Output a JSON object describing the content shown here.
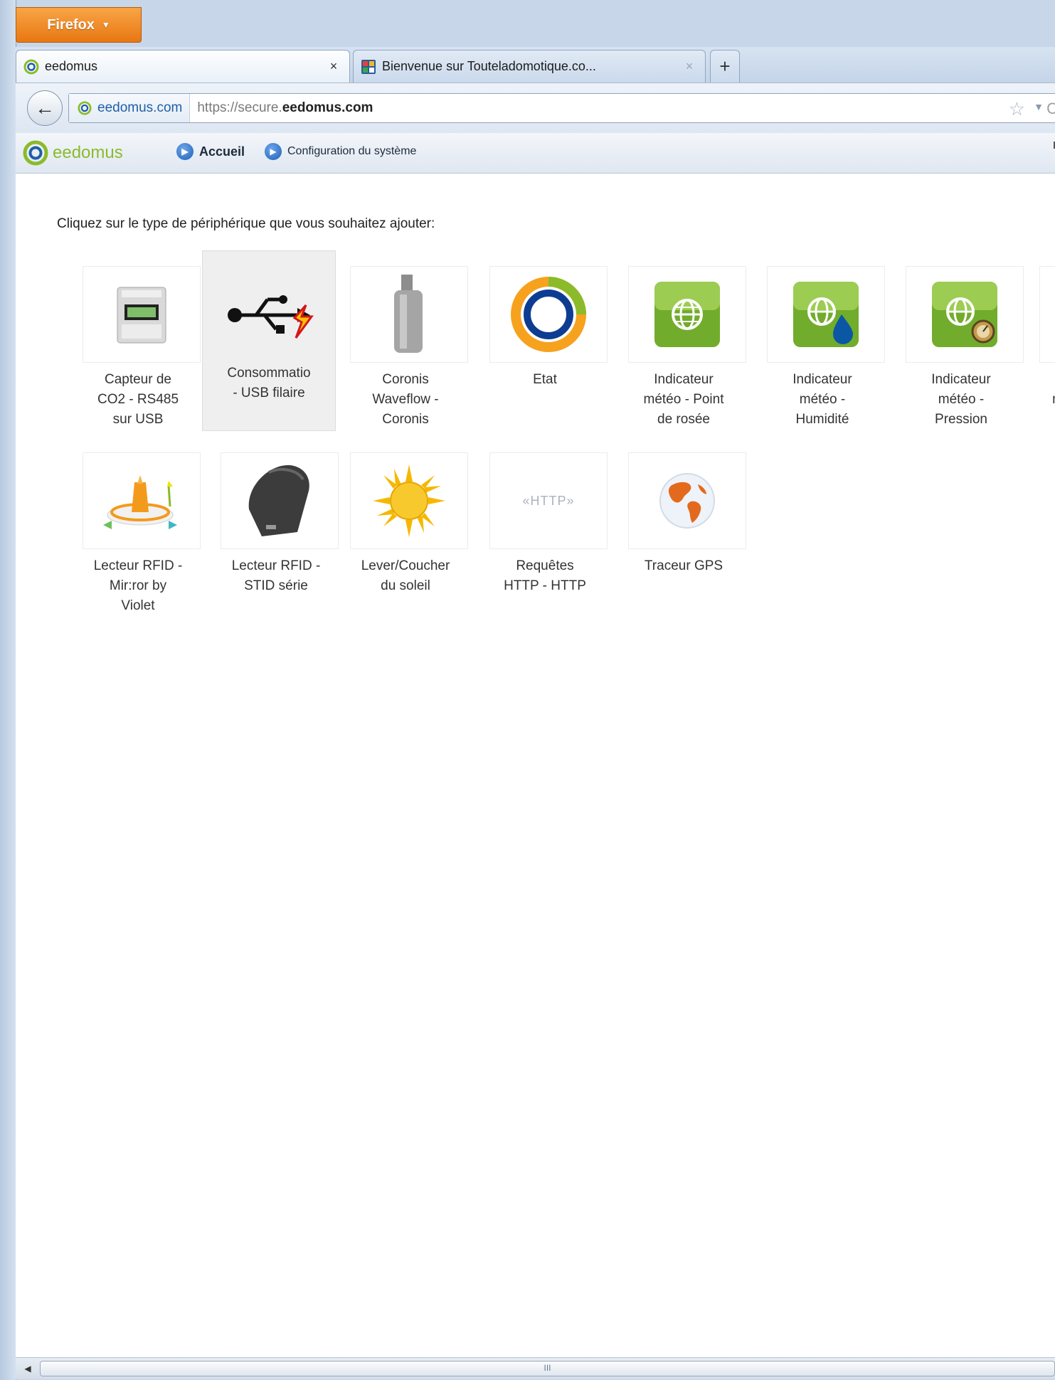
{
  "browser": {
    "menu_button": "Firefox",
    "tabs": [
      {
        "title": "eedomus",
        "active": true
      },
      {
        "title": "Bienvenue sur Touteladomotique.co...",
        "active": false
      }
    ],
    "new_tab_label": "+",
    "close_label": "×",
    "identity": "eedomus.com",
    "url_prefix": "https://secure.",
    "url_domain": "eedomus.com"
  },
  "app": {
    "logo_text": "eedomus",
    "nav": [
      {
        "label": "Accueil"
      },
      {
        "label": "Configuration du système"
      }
    ]
  },
  "content": {
    "instruction": "Cliquez sur le type de périphérique que vous souhaitez ajouter:",
    "devices": [
      {
        "label": "Capteur de\nCO2 - RS485\nsur USB",
        "icon": "co2-sensor-icon"
      },
      {
        "label": "Consommatio\n- USB filaire",
        "icon": "usb-icon",
        "selected": true
      },
      {
        "label": "Coronis\nWaveflow -\nCoronis",
        "icon": "waveflow-module-icon"
      },
      {
        "label": "Etat",
        "icon": "state-ring-icon"
      },
      {
        "label": "Indicateur\nmétéo - Point\nde rosée",
        "icon": "weather-globe-icon"
      },
      {
        "label": "Indicateur\nmétéo -\nHumidité",
        "icon": "weather-humidity-icon"
      },
      {
        "label": "Indicateur\nmétéo -\nPression",
        "icon": "weather-pressure-icon"
      },
      {
        "label": "I\nm\nT",
        "icon": "weather-partial-icon"
      },
      {
        "label": "Lecteur RFID -\nMir:ror by\nViolet",
        "icon": "mirror-rfid-icon"
      },
      {
        "label": "Lecteur RFID -\nSTID série",
        "icon": "stid-rfid-icon"
      },
      {
        "label": "Lever/Coucher\ndu soleil",
        "icon": "sun-icon"
      },
      {
        "label": "Requêtes\nHTTP - HTTP",
        "icon": "http-icon"
      },
      {
        "label": "Traceur GPS",
        "icon": "globe-gps-icon"
      }
    ],
    "http_icon_text": "«HTTP»"
  },
  "scrollbar": {
    "thumb_grip": "III"
  }
}
